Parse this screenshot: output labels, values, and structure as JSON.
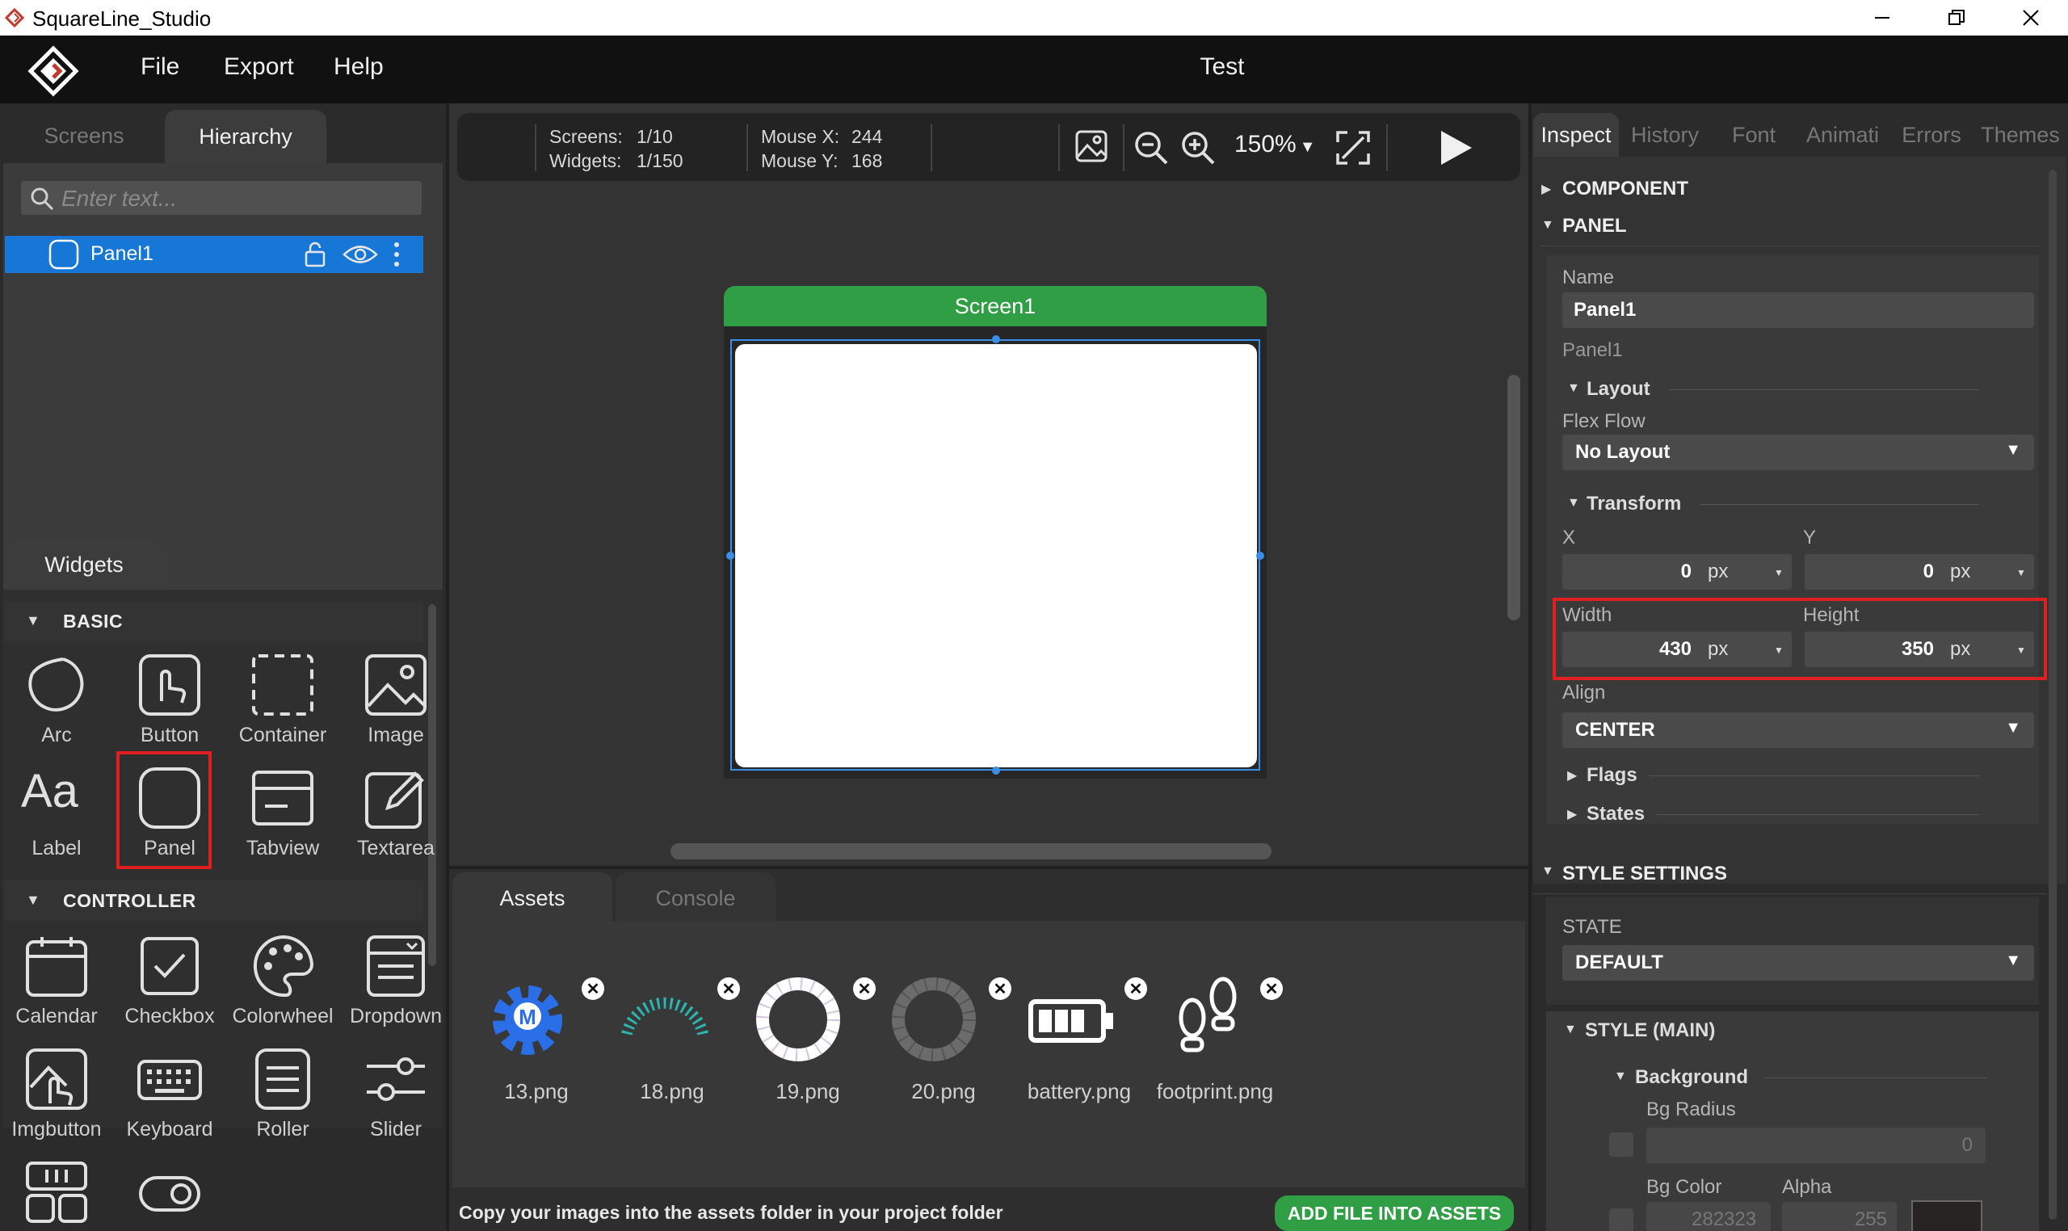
{
  "window": {
    "title": "SquareLine_Studio"
  },
  "menu": {
    "items": [
      "File",
      "Export",
      "Help"
    ],
    "project_title": "Test"
  },
  "left": {
    "tabs": [
      "Screens",
      "Hierarchy"
    ],
    "search_placeholder": "Enter text...",
    "hierarchy": [
      {
        "label": "Panel1"
      }
    ],
    "widgets_tab": "Widgets",
    "sections": {
      "basic": "BASIC",
      "basic_items": [
        "Arc",
        "Button",
        "Container",
        "Image",
        "Label",
        "Panel",
        "Tabview",
        "Textarea"
      ],
      "controller": "CONTROLLER",
      "controller_items": [
        "Calendar",
        "Checkbox",
        "Colorwheel",
        "Dropdown",
        "Imgbutton",
        "Keyboard",
        "Roller",
        "Slider"
      ]
    }
  },
  "toolbar": {
    "screens_label": "Screens:",
    "screens_value": "1/10",
    "widgets_label": "Widgets:",
    "widgets_value": "1/150",
    "mouse_x_label": "Mouse X:",
    "mouse_x_value": "244",
    "mouse_y_label": "Mouse Y:",
    "mouse_y_value": "168",
    "zoom": "150%"
  },
  "canvas": {
    "screen_name": "Screen1"
  },
  "bottom": {
    "tabs": [
      "Assets",
      "Console"
    ],
    "assets": [
      "13.png",
      "18.png",
      "19.png",
      "20.png",
      "battery.png",
      "footprint.png"
    ],
    "hint": "Copy your images into the assets folder in your project folder",
    "add_button": "ADD FILE INTO ASSETS"
  },
  "inspector": {
    "tabs": [
      "Inspect",
      "History",
      "Font",
      "Animati",
      "Errors",
      "Themes"
    ],
    "component_header": "COMPONENT",
    "panel_header": "PANEL",
    "name_label": "Name",
    "name_value": "Panel1",
    "type_text": "Panel1",
    "layout_header": "Layout",
    "flex_flow_label": "Flex Flow",
    "flex_flow_value": "No Layout",
    "transform_header": "Transform",
    "x_label": "X",
    "x_value": "0",
    "y_label": "Y",
    "y_value": "0",
    "width_label": "Width",
    "width_value": "430",
    "height_label": "Height",
    "height_value": "350",
    "unit": "px",
    "align_label": "Align",
    "align_value": "CENTER",
    "flags_header": "Flags",
    "states_header": "States",
    "style_settings_header": "STYLE SETTINGS",
    "state_label": "STATE",
    "state_value": "DEFAULT",
    "style_main_header": "STYLE (MAIN)",
    "background_header": "Background",
    "bg_radius_label": "Bg Radius",
    "bg_radius_value": "0",
    "bg_color_label": "Bg Color",
    "bg_color_value": "282323",
    "alpha_label": "Alpha",
    "alpha_value": "255"
  },
  "colors": {
    "accent_blue": "#1677d6",
    "accent_green": "#2f9e44",
    "highlight_red": "#e02020"
  }
}
